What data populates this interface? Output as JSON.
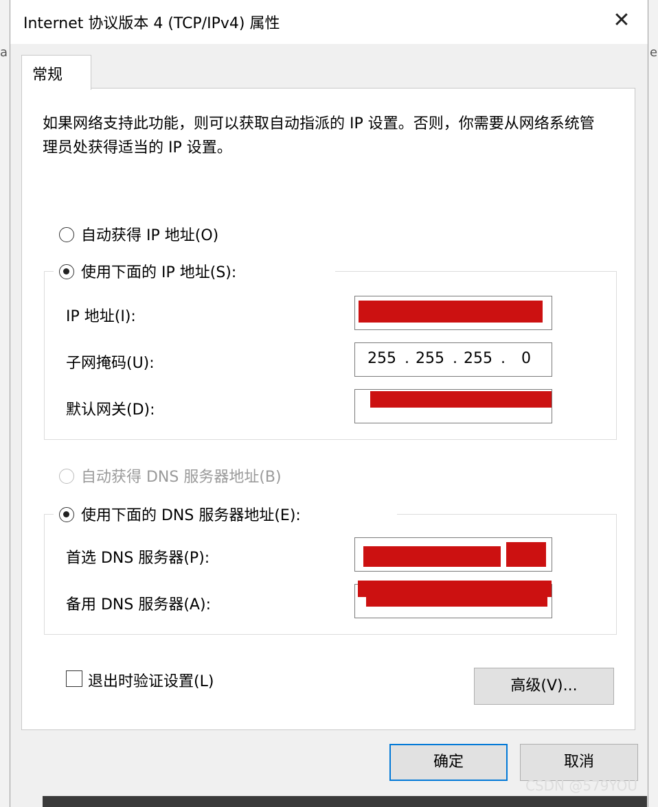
{
  "window": {
    "title": "Internet 协议版本 4 (TCP/IPv4) 属性",
    "close_glyph": "✕"
  },
  "background": {
    "left_char": "a",
    "right_char": "e"
  },
  "tabs": [
    {
      "label": "常规"
    }
  ],
  "description": "如果网络支持此功能，则可以获取自动指派的 IP 设置。否则，你需要从网络系统管理员处获得适当的 IP 设置。",
  "ip": {
    "auto_label": "自动获得 IP 地址(O)",
    "manual_label": "使用下面的 IP 地址(S):",
    "selected": "manual",
    "fields": [
      {
        "label": "IP 地址(I):",
        "value": ""
      },
      {
        "label": "子网掩码(U):",
        "segments": [
          "255",
          "255",
          "255",
          "0"
        ]
      },
      {
        "label": "默认网关(D):",
        "value": ""
      }
    ]
  },
  "dns": {
    "auto_label": "自动获得 DNS 服务器地址(B)",
    "manual_label": "使用下面的 DNS 服务器地址(E):",
    "selected": "manual",
    "fields": [
      {
        "label": "首选 DNS 服务器(P):",
        "value": ""
      },
      {
        "label": "备用 DNS 服务器(A):",
        "value": ""
      }
    ]
  },
  "validate": {
    "label": "退出时验证设置(L)",
    "checked": false
  },
  "buttons": {
    "advanced": "高级(V)...",
    "ok": "确定",
    "cancel": "取消"
  },
  "watermark": "CSDN @579YOU",
  "colors": {
    "redaction": "#cc1111",
    "default_button_border": "#0078d7"
  }
}
